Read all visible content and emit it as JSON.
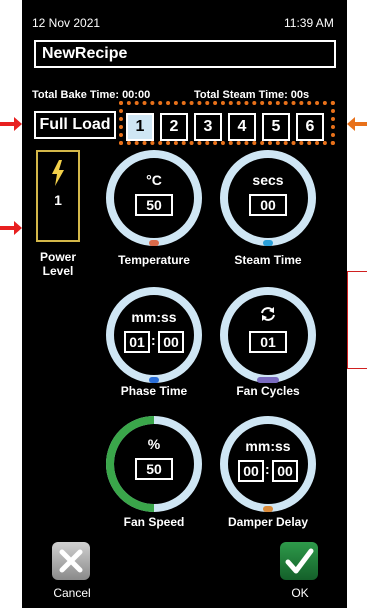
{
  "status": {
    "date": "12 Nov 2021",
    "time": "11:39 AM"
  },
  "recipe_name": "NewRecipe",
  "totals": {
    "bake": "Total Bake Time: 00:00",
    "steam": "Total Steam Time: 00s"
  },
  "load_button": "Full Load",
  "phase_tabs": [
    "1",
    "2",
    "3",
    "4",
    "5",
    "6"
  ],
  "active_phase": "1",
  "power": {
    "value": "1",
    "label_line1": "Power",
    "label_line2": "Level"
  },
  "dials": {
    "temperature": {
      "unit": "°C",
      "value": "50",
      "label": "Temperature",
      "dot_color": "#d96a4a"
    },
    "steam_time": {
      "unit": "secs",
      "value": "00",
      "label": "Steam Time",
      "dot_color": "#2a9fd8"
    },
    "phase_time": {
      "unit": "mm:ss",
      "min": "01",
      "sec": "00",
      "label": "Phase Time",
      "dot_color": "#2a6ed8"
    },
    "fan_cycles": {
      "icon": "refresh-icon",
      "value": "01",
      "label": "Fan Cycles",
      "dot_color": "#7a6bc0"
    },
    "fan_speed": {
      "unit": "%",
      "value": "50",
      "label": "Fan Speed",
      "fill_fraction": 0.5,
      "fill_color": "#3aa64a"
    },
    "damper_delay": {
      "unit": "mm:ss",
      "min": "00",
      "sec": "00",
      "label": "Damper Delay",
      "dot_color": "#d98a3a"
    }
  },
  "footer": {
    "cancel": "Cancel",
    "ok": "OK"
  },
  "colors": {
    "background": "#000000",
    "dial_ring": "#cfe6f4",
    "highlight": "#e8711a",
    "marker": "#e82020",
    "power_border": "#d4b84a"
  }
}
